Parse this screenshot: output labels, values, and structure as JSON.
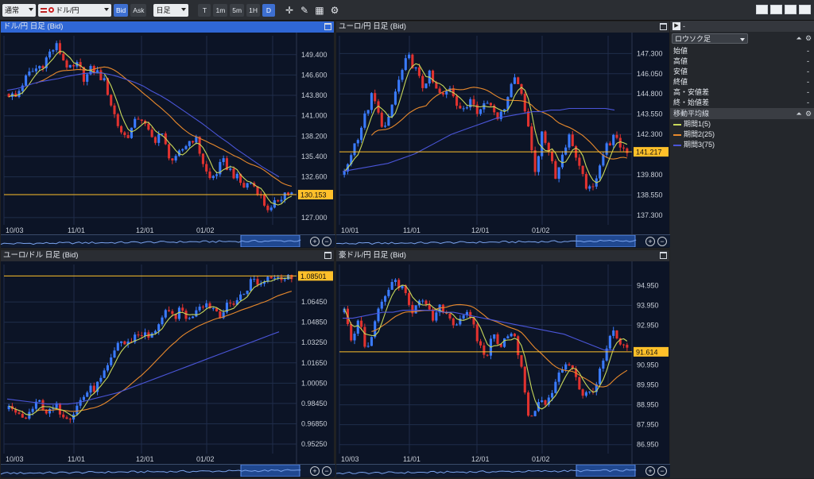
{
  "toolbar": {
    "mode": "通常",
    "pair": "ドル/円",
    "bid": "Bid",
    "ask": "Ask",
    "period": "日足",
    "tf": [
      "T",
      "1m",
      "5m",
      "1H",
      "D"
    ],
    "tf_active": "D"
  },
  "charts": [
    {
      "title": "ドル/円 日足 (Bid)",
      "selected": true,
      "yticks": [
        "149.400",
        "146.600",
        "143.800",
        "141.000",
        "138.200",
        "135.400",
        "132.600",
        "130.153",
        "127.000"
      ],
      "xticks": [
        "10/03",
        "11/01",
        "12/01",
        "01/02"
      ],
      "price": "130.153",
      "ymin": 126.0,
      "ymax": 152.0,
      "path": [
        144.0,
        143.5,
        145.5,
        146.8,
        147.5,
        148.2,
        149.8,
        150.6,
        148.5,
        147.2,
        148.0,
        146.0,
        147.5,
        146.8,
        145.4,
        142.0,
        139.2,
        138.0,
        139.5,
        141.2,
        139.0,
        137.5,
        138.8,
        136.0,
        134.5,
        136.2,
        137.4,
        138.1,
        135.0,
        132.2,
        133.0,
        134.7,
        133.6,
        132.5,
        131.2,
        131.9,
        130.9,
        128.9,
        127.9,
        129.5,
        130.4,
        130.2
      ],
      "ma75": [
        144.5,
        144.7,
        145.0,
        145.4,
        145.7,
        145.9,
        146.1,
        146.4,
        146.6,
        146.8,
        146.9,
        146.9,
        146.7,
        146.4,
        146.0,
        145.6,
        145.1,
        144.4,
        143.8,
        143.1,
        142.3,
        141.5,
        140.7,
        139.9,
        139.0,
        138.1,
        137.3,
        136.4,
        135.6,
        134.8,
        134.0,
        133.3,
        132.6
      ]
    },
    {
      "title": "ユーロ/円 日足 (Bid)",
      "selected": false,
      "yticks": [
        "147.300",
        "146.050",
        "144.800",
        "143.550",
        "142.300",
        "141.217",
        "139.800",
        "138.550",
        "137.300"
      ],
      "xticks": [
        "10/01",
        "11/01",
        "12/01",
        "01/02"
      ],
      "price": "141.217",
      "ymin": 136.7,
      "ymax": 148.4,
      "path": [
        139.8,
        141.2,
        142.3,
        143.5,
        144.8,
        143.2,
        142.6,
        144.6,
        146.0,
        147.1,
        146.4,
        145.2,
        146.0,
        145.0,
        144.6,
        145.3,
        144.2,
        143.6,
        144.8,
        143.6,
        144.4,
        144.1,
        143.2,
        144.6,
        145.9,
        145.2,
        142.6,
        140.1,
        142.3,
        141.3,
        139.6,
        141.4,
        142.3,
        140.4,
        139.3,
        138.6,
        140.4,
        141.5,
        142.1,
        141.6,
        141.3
      ],
      "ma75": [
        140.0,
        140.1,
        140.2,
        140.3,
        140.4,
        140.5,
        140.7,
        140.9,
        141.1,
        141.4,
        141.7,
        142.0,
        142.3,
        142.5,
        142.7,
        142.9,
        143.1,
        143.3,
        143.4,
        143.5,
        143.6,
        143.7,
        143.7,
        143.8,
        143.8,
        143.9,
        143.9,
        143.9,
        143.9,
        143.9,
        143.8
      ]
    },
    {
      "title": "ユーロ/ドル 日足 (Bid)",
      "selected": false,
      "yticks": [
        "1.08501",
        "1.06450",
        "1.04850",
        "1.03250",
        "1.01650",
        "1.00050",
        "0.98450",
        "0.96850",
        "0.95250"
      ],
      "xticks": [
        "10/03",
        "11/01",
        "12/01",
        "01/02"
      ],
      "price": "1.08501",
      "ymin": 0.945,
      "ymax": 1.094,
      "path": [
        0.98,
        0.975,
        0.972,
        0.98,
        0.986,
        0.976,
        0.982,
        0.976,
        0.975,
        0.986,
        0.994,
        0.997,
        1.005,
        1.018,
        1.035,
        1.03,
        1.038,
        1.04,
        1.035,
        1.048,
        1.055,
        1.053,
        1.058,
        1.05,
        1.062,
        1.064,
        1.06,
        1.055,
        1.062,
        1.066,
        1.072,
        1.083,
        1.078,
        1.085,
        1.087,
        1.082,
        1.085
      ],
      "ma75": [
        0.988,
        0.987,
        0.986,
        0.985,
        0.984,
        0.984,
        0.984,
        0.985,
        0.987,
        0.989,
        0.991,
        0.993,
        0.996,
        0.999,
        1.002,
        1.005,
        1.008,
        1.011,
        1.014,
        1.017,
        1.02,
        1.023,
        1.026,
        1.029,
        1.032,
        1.035,
        1.038,
        1.041
      ]
    },
    {
      "title": "豪ドル/円 日足 (Bid)",
      "selected": false,
      "yticks": [
        "94.950",
        "93.950",
        "92.950",
        "91.614",
        "90.950",
        "89.950",
        "88.950",
        "87.950",
        "86.950"
      ],
      "xticks": [
        "10/03",
        "11/01",
        "12/01",
        "01/02"
      ],
      "price": "91.614",
      "ymin": 86.5,
      "ymax": 96.0,
      "path": [
        93.6,
        92.2,
        93.4,
        91.5,
        93.0,
        94.0,
        94.8,
        95.2,
        94.6,
        93.6,
        94.4,
        93.8,
        93.2,
        93.9,
        93.4,
        93.0,
        93.6,
        93.2,
        92.1,
        91.3,
        92.5,
        92.0,
        92.6,
        92.2,
        90.3,
        87.9,
        89.3,
        88.9,
        89.6,
        90.6,
        91.2,
        90.6,
        89.3,
        89.6,
        90.1,
        91.4,
        92.6,
        92.0,
        91.6
      ],
      "ma75": [
        93.3,
        93.3,
        93.4,
        93.5,
        93.6,
        93.6,
        93.7,
        93.7,
        93.7,
        93.7,
        93.6,
        93.6,
        93.5,
        93.4,
        93.3,
        93.2,
        93.1,
        93.0,
        92.9,
        92.8,
        92.7,
        92.6,
        92.5,
        92.3,
        92.1,
        91.9,
        91.7,
        91.7
      ]
    }
  ],
  "side": {
    "title": "-",
    "chart_type": "ロウソク足",
    "ohlc": [
      {
        "label": "始値",
        "value": "-"
      },
      {
        "label": "高値",
        "value": "-"
      },
      {
        "label": "安値",
        "value": "-"
      },
      {
        "label": "終値",
        "value": "-"
      },
      {
        "label": "高・安値差",
        "value": "-"
      },
      {
        "label": "終・始値差",
        "value": "-"
      }
    ],
    "ma_title": "移動平均線",
    "ma": [
      {
        "label": "期間1(5)",
        "color": "#c8d85a"
      },
      {
        "label": "期間2(25)",
        "color": "#e8892c"
      },
      {
        "label": "期間3(75)",
        "color": "#4a55d8"
      }
    ]
  },
  "colors": {
    "up": "#3a7bff",
    "down": "#e0322f",
    "price_line": "#ffc02a",
    "ma5": "#c8d85a",
    "ma25": "#e8892c",
    "ma75": "#4a55d8"
  }
}
